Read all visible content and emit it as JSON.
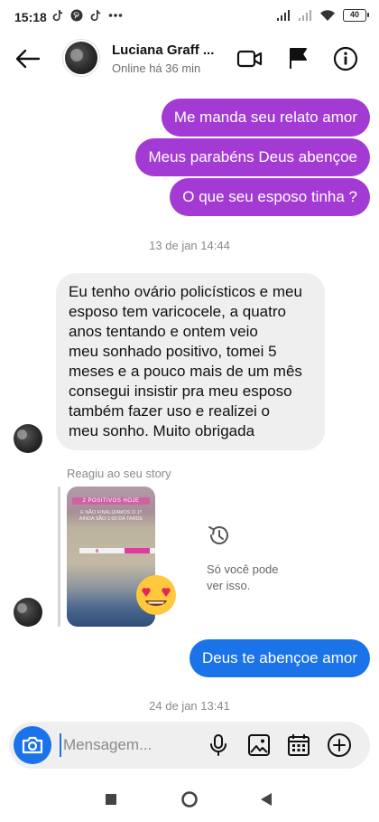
{
  "status_bar": {
    "time": "15:18",
    "left_icons": [
      "tiktok-icon",
      "pinterest-icon",
      "tiktok-icon",
      "more-dots-icon"
    ],
    "right_icons": [
      "signal-icon",
      "signal-empty-icon",
      "wifi-icon",
      "battery-icon"
    ],
    "battery_level": "40"
  },
  "header": {
    "contact_name": "Luciana Graff ...",
    "status": "Online há 36 min",
    "icons": [
      "back-arrow-icon",
      "video-call-icon",
      "flag-icon",
      "info-icon"
    ]
  },
  "messages": [
    {
      "kind": "sent",
      "text": "Me manda seu relato amor"
    },
    {
      "kind": "sent",
      "text": "Meus parabéns Deus abençoe"
    },
    {
      "kind": "sent",
      "text": "O que seu esposo tinha ?"
    },
    {
      "kind": "timestamp",
      "text": "13 de jan 14:44"
    },
    {
      "kind": "received",
      "lines": [
        "Eu tenho ovário policísticos e meu",
        "esposo tem varicocele, a quatro",
        "anos tentando e ontem veio",
        "meu sonhado positivo, tomei 5",
        "meses e a pouco mais de um mês",
        "consegui insistir pra meu esposo",
        "também fazer uso e  realizei o",
        "meu sonho. Muito obrigada"
      ]
    },
    {
      "kind": "story_reaction",
      "caption": "Reagiu ao seu story",
      "reaction_emoji": "heart-eyes-emoji",
      "story_header": "2 POSITIVOS HOJE",
      "story_lines": [
        "E NÃO FINALIZAMOS O 1º",
        "AINDA SÃO 1:00 DA TARDE"
      ],
      "note": "Só você pode ver isso."
    },
    {
      "kind": "sent",
      "text": "Deus te abençoe amor"
    },
    {
      "kind": "timestamp",
      "text": "24 de jan 13:41"
    }
  ],
  "composer": {
    "placeholder": "Mensagem...",
    "icons": [
      "camera-icon",
      "microphone-icon",
      "gallery-icon",
      "calendar-icon",
      "add-circle-icon"
    ]
  },
  "nav_bar": {
    "buttons": [
      "recents-square-icon",
      "home-circle-icon",
      "back-triangle-icon"
    ]
  },
  "colors": {
    "sent_bubble": "#a33ad3",
    "sent_bubble_latest": "#1a73e8",
    "received_bubble": "#efefef",
    "accent": "#1a73e8"
  }
}
